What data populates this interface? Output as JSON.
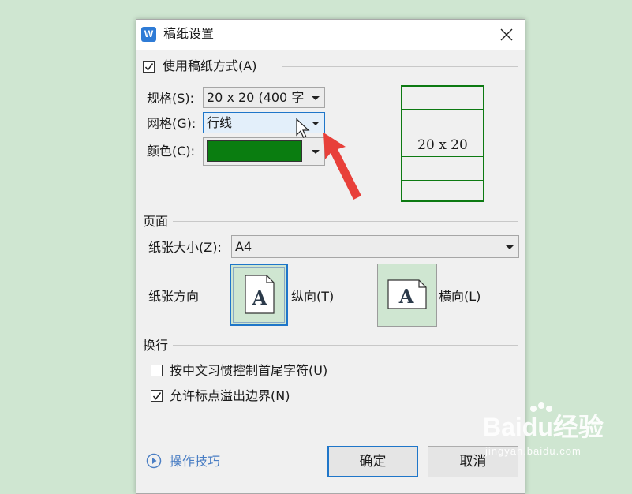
{
  "dialog": {
    "title": "稿纸设置",
    "use_manuscript": {
      "label": "使用稿纸方式(A)",
      "checked": true
    },
    "spec": {
      "label": "规格(S):",
      "value": "20 x 20 (400 字"
    },
    "grid": {
      "label": "网格(G):",
      "value": "行线"
    },
    "color": {
      "label": "颜色(C):",
      "value": "#0a7d10"
    },
    "preview_text": "20 x 20",
    "page_section": "页面",
    "paper_size": {
      "label": "纸张大小(Z):",
      "value": "A4"
    },
    "orientation": {
      "label": "纸张方向",
      "portrait": "纵向(T)",
      "landscape": "横向(L)",
      "selected": "portrait",
      "icon_letter": "A"
    },
    "linebreak_section": "换行",
    "chinese_habit": {
      "label": "按中文习惯控制首尾字符(U)",
      "checked": false
    },
    "allow_punct": {
      "label": "允许标点溢出边界(N)",
      "checked": true
    },
    "tips_link": "操作技巧",
    "ok_button": "确定",
    "cancel_button": "取消"
  },
  "watermark": {
    "brand": "Baidu经验",
    "url": "jingyan.baidu.com"
  },
  "colors": {
    "accent": "#1f76c9",
    "grid_green": "#0d7a12",
    "arrow_red": "#e8403a"
  }
}
